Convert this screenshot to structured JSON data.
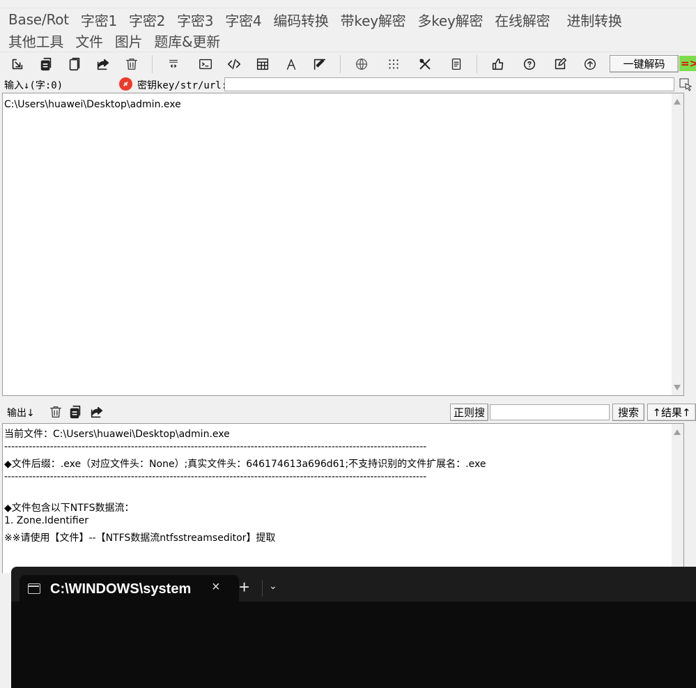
{
  "menu": {
    "row1": [
      "Base/Rot",
      "字密1",
      "字密2",
      "字密3",
      "字密4",
      "编码转换",
      "带key解密",
      "多key解密",
      "在线解密",
      "进制转换"
    ],
    "row2": [
      "其他工具",
      "文件",
      "图片",
      "题库&更新"
    ]
  },
  "toolbar": {
    "icons": [
      "import-icon",
      "copy-icon",
      "paste-icon",
      "share-icon",
      "trash-icon",
      "base-icon",
      "terminal-icon",
      "code-icon",
      "calculator-icon",
      "font-icon",
      "brush-icon",
      "globe-icon",
      "grid-icon",
      "tools-icon",
      "document-icon",
      "thumbs-up-icon",
      "help-icon",
      "edit-icon",
      "upload-icon"
    ],
    "one_key_decode": "一键解码",
    "arrow_tag": "=>"
  },
  "key_bar": {
    "input_label": "输入↓(字:0)",
    "key_label": "密钥key/str/url:",
    "key_value": ""
  },
  "input_panel": {
    "text": "C:\\Users\\huawei\\Desktop\\admin.exe"
  },
  "output_bar": {
    "label": "输出↓",
    "regex_button": "正则搜",
    "search_value": "",
    "search_button": "搜索",
    "result_button": "↑结果↑"
  },
  "output_panel": {
    "lines": [
      "当前文件：C:\\Users\\huawei\\Desktop\\admin.exe",
      "------------------------------------------------------------------------------------------------------------------------",
      "◆文件后缀：.exe（对应文件头：None）;真实文件头：646174613a696d61;不支持识别的文件扩展名：.exe",
      "------------------------------------------------------------------------------------------------------------------------",
      "",
      "◆文件包含以下NTFS数据流：",
      "1. Zone.Identifier",
      "※※请使用【文件】--【NTFS数据流ntfsstreamseditor】提取"
    ]
  },
  "terminal": {
    "tab_title": "C:\\WINDOWS\\system",
    "close_glyph": "×",
    "new_tab_glyph": "+",
    "dropdown_glyph": "⌄"
  },
  "colors": {
    "accent_red": "#ee3a2a",
    "arrow_bg": "#7ddc4b",
    "terminal_bg": "#0c0c0c"
  }
}
